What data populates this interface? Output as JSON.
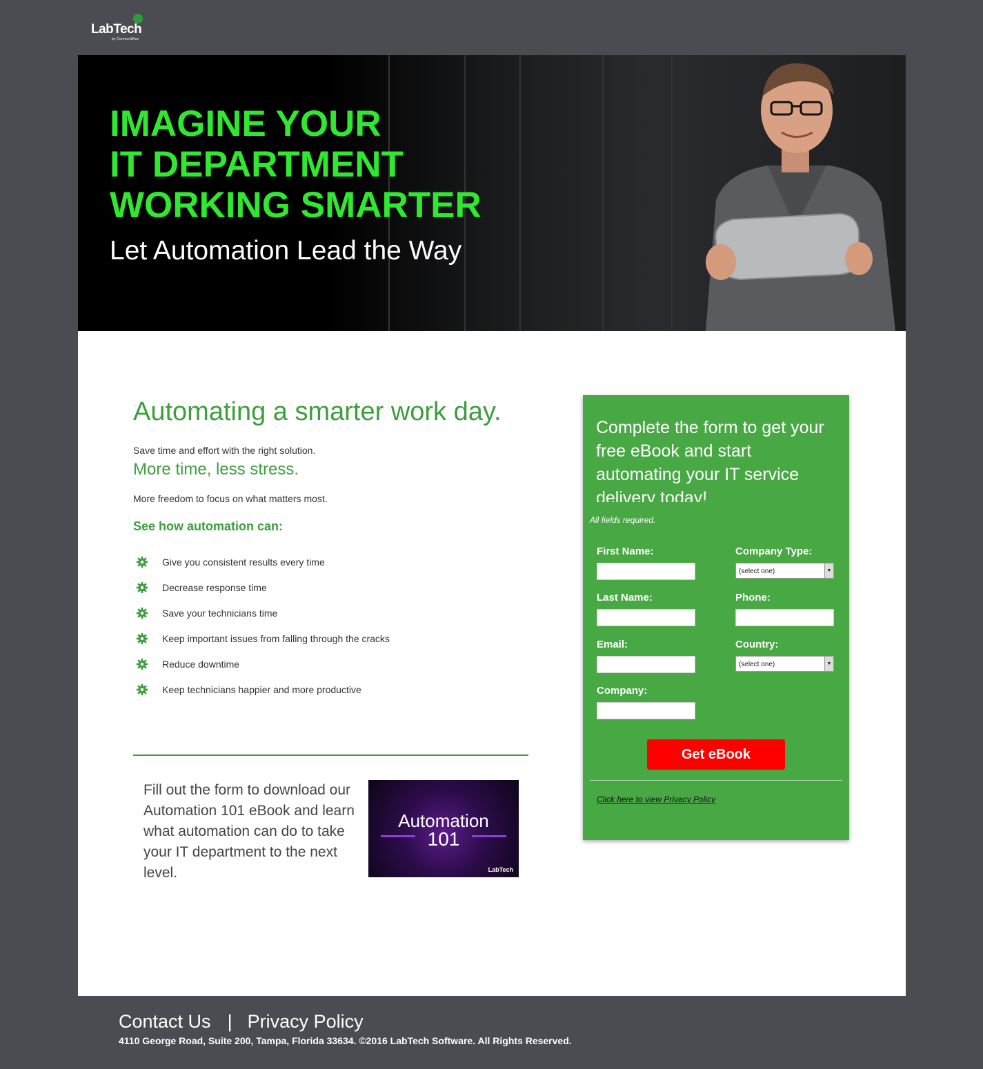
{
  "brand": {
    "name": "LabTech",
    "tagline": "by ConnectWise"
  },
  "hero": {
    "headline_lines": [
      "IMAGINE YOUR",
      "IT DEPARTMENT",
      "WORKING SMARTER"
    ],
    "subheadline": "Let Automation Lead the Way",
    "accent_color": "#2fe82f"
  },
  "main": {
    "title": "Automating a smarter work day.",
    "intro": "Save time and effort with the right solution.",
    "subtitle": "More time, less stress.",
    "body": "More freedom to focus on what matters most.",
    "list_heading": "See how automation can:",
    "bullets": [
      "Give you consistent results every time",
      "Decrease response time",
      "Save your technicians time",
      "Keep important issues from falling through the cracks",
      "Reduce downtime",
      "Keep technicians happier and more productive"
    ],
    "download_text": "Fill out the form to download our Automation 101 eBook and learn what automation can do to take your IT department to the next level.",
    "ebook": {
      "title": "Automation",
      "number": "101",
      "brand": "LabTech"
    }
  },
  "form": {
    "title": "Complete the form to get your free eBook and start automating your IT service delivery today!",
    "required_note": "All fields required.",
    "fields": {
      "first_name": "First Name:",
      "last_name": "Last Name:",
      "email": "Email:",
      "company": "Company:",
      "company_type": "Company Type:",
      "phone": "Phone:",
      "country": "Country:"
    },
    "select_placeholder": "(select one)",
    "submit_label": "Get eBook",
    "privacy_link": "Click here to view Privacy Policy",
    "colors": {
      "panel": "#48a844",
      "button": "#fe0000"
    }
  },
  "footer": {
    "contact": "Contact Us",
    "separator": "|",
    "privacy": "Privacy Policy",
    "address": "4110 George Road, Suite 200, Tampa, Florida 33634. ©2016 LabTech Software. All Rights Reserved."
  }
}
